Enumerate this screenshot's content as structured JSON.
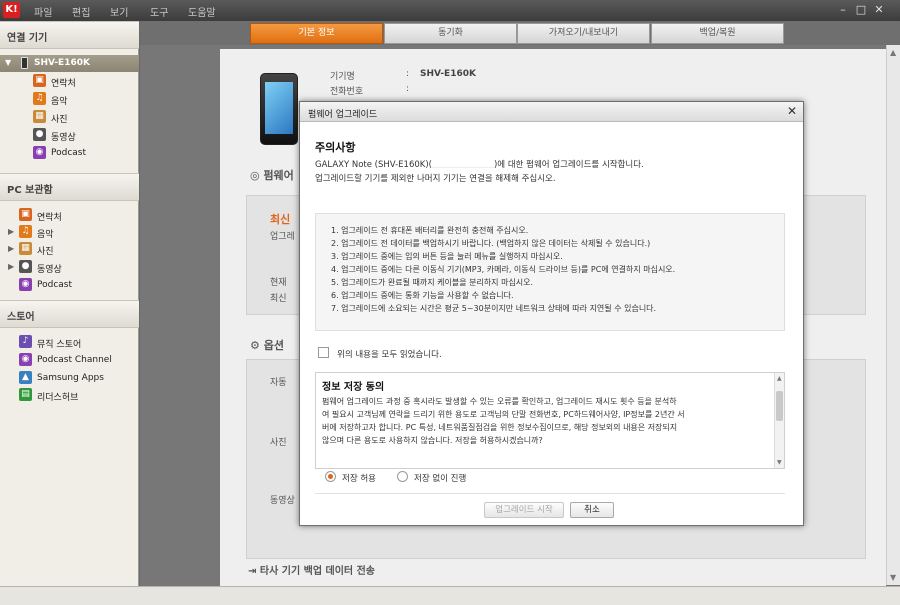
{
  "app": {
    "icon_text": "K!",
    "menu": [
      "파일",
      "편집",
      "보기",
      "도구",
      "도움말"
    ],
    "window_controls": [
      "–",
      "□",
      "✕"
    ]
  },
  "sidebar": {
    "connected_header": "연결 기기",
    "device": {
      "name": "SHV-E160K"
    },
    "device_items": [
      {
        "label": "연락처",
        "icon": "contacts-icon",
        "color": "#d9661f"
      },
      {
        "label": "음악",
        "icon": "music-icon",
        "color": "#e07a1a"
      },
      {
        "label": "사진",
        "icon": "photo-icon",
        "color": "#c98a3a"
      },
      {
        "label": "동영상",
        "icon": "video-icon",
        "color": "#555555"
      },
      {
        "label": "Podcast",
        "icon": "podcast-icon",
        "color": "#8a3fb0"
      }
    ],
    "pc_header": "PC 보관함",
    "pc_items": [
      {
        "label": "연락처",
        "icon": "contacts-icon",
        "color": "#d9661f"
      },
      {
        "label": "음악",
        "icon": "music-icon",
        "color": "#e07a1a"
      },
      {
        "label": "사진",
        "icon": "photo-icon",
        "color": "#c98a3a"
      },
      {
        "label": "동영상",
        "icon": "video-icon",
        "color": "#555555"
      },
      {
        "label": "Podcast",
        "icon": "podcast-icon",
        "color": "#8a3fb0"
      }
    ],
    "store_header": "스토어",
    "store_items": [
      {
        "label": "뮤직 스토어",
        "icon": "music-store-icon",
        "color": "#6a4fb0"
      },
      {
        "label": "Podcast Channel",
        "icon": "podcast-channel-icon",
        "color": "#8a3fb0"
      },
      {
        "label": "Samsung Apps",
        "icon": "samsung-apps-icon",
        "color": "#3a7fc0"
      },
      {
        "label": "리더스허브",
        "icon": "readers-hub-icon",
        "color": "#2f9a3a"
      }
    ]
  },
  "tabs": [
    "기본 정보",
    "동기화",
    "가져오기/내보내기",
    "백업/복원"
  ],
  "main": {
    "device_model_label": "기기명",
    "device_model_value": "SHV-E160K",
    "phone_number_label": "전화번호",
    "colon": ":",
    "firmware_head": "펌웨어",
    "latest_label": "최신",
    "update_label": "업그레",
    "current_label": "현재",
    "latest_ver_label": "최신",
    "options_head": "옵션",
    "auto_label": "자동",
    "photo_label": "사진",
    "video_label": "동영상",
    "transfer_head": "타사 기기 백업 데이터 전송"
  },
  "dialog": {
    "title": "펌웨어 업그레이드",
    "caution_head": "주의사항",
    "intro_line1_a": "GALAXY Note (SHV-E160K)(",
    "intro_line1_b": ")에 대한 펌웨어 업그레이드를 시작합니다.",
    "intro_line2": "업그레이드할 기기를 제외한 나머지 기기는 연결을 해제해 주십시오.",
    "notices": [
      "1. 업그레이드 전 휴대폰 배터리를 완전히 충전해 주십시오.",
      "2. 업그레이드 전 데이터를 백업하시기 바랍니다. (백업하지 않은 데이터는 삭제될 수 있습니다.)",
      "3. 업그레이드 중에는 임의 버튼 등을 눌러 메뉴를 실행하지 마십시오.",
      "4. 업그레이드 중에는 다른 이동식 기기(MP3, 카메라, 이동식 드라이브 등)를 PC에 연결하지 마십시오.",
      "5. 업그레이드가 완료될 때까지 케이블을 분리하지 마십시오.",
      "6. 업그레이드 중에는 통화 기능을 사용할 수 없습니다.",
      "7. 업그레이드에 소요되는 시간은 평균 5~30분이지만 네트워크 상태에 따라 지연될 수 있습니다."
    ],
    "read_all_label": "위의 내용을 모두 읽었습니다.",
    "consent_head": "정보 저장 동의",
    "consent_lines": [
      "펌웨어 업그레이드 과정 중 혹시라도 발생할 수 있는 오류를 확인하고, 업그레이드 재시도 횟수 등을 분석하",
      "여 필요시 고객님께 연락을 드리기 위한 용도로 고객님의 단말 전화번호, PC하드웨어사양, IP정보를 2년간 서",
      "버에 저장하고자 합니다. PC 특성, 네트워품질점검을 위한 정보수집이므로, 해당 정보외의 내용은 저장되지",
      "않으며 다른 용도로 사용하지 않습니다. 저장을 허용하시겠습니까?"
    ],
    "radio_allow": "저장 허용",
    "radio_deny": "저장 없이 진행",
    "start_button": "업그레이드 시작",
    "cancel_button": "취소"
  }
}
